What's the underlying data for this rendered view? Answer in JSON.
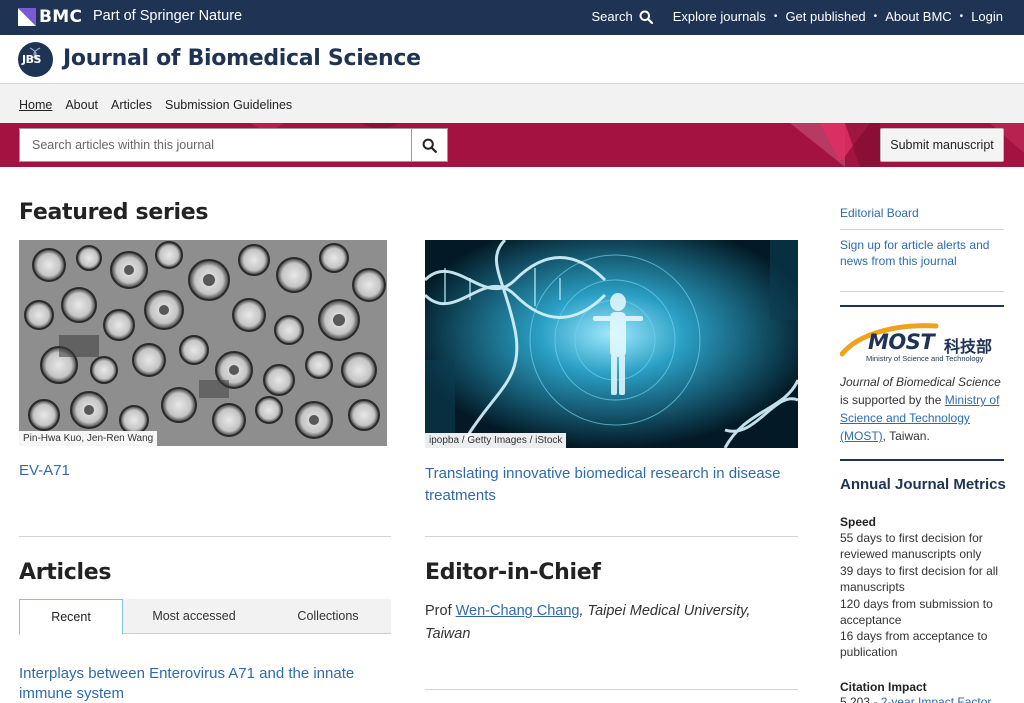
{
  "topbar": {
    "brand": "BMC",
    "tagline": "Part of Springer Nature",
    "search_label": "Search",
    "nav": [
      "Explore journals",
      "Get published",
      "About BMC",
      "Login"
    ],
    "separator": "•"
  },
  "journal": {
    "logo_text": "JBS",
    "title": "Journal of Biomedical Science"
  },
  "subnav": {
    "items": [
      "Home",
      "About",
      "Articles",
      "Submission Guidelines"
    ],
    "active": "Home"
  },
  "search": {
    "placeholder": "Search articles within this journal",
    "submit_manuscript": "Submit manuscript"
  },
  "featured": {
    "title": "Featured series",
    "items": [
      {
        "credit": "Pin-Hwa Kuo, Jen-Ren Wang",
        "link": "EV-A71"
      },
      {
        "credit": "ipopba / Getty Images / iStock",
        "link": "Translating innovative biomedical research in disease treatments"
      }
    ]
  },
  "articles": {
    "title": "Articles",
    "tabs": [
      "Recent",
      "Most accessed",
      "Collections"
    ],
    "active_tab": "Recent",
    "first_article": "Interplays between Enterovirus A71 and the innate immune system"
  },
  "editor": {
    "title": "Editor-in-Chief",
    "prefix": "Prof ",
    "name": "Wen-Chang Chang",
    "affiliation": ", Taipei Medical University, Taiwan"
  },
  "sidebar": {
    "editorial_board": "Editorial Board",
    "alerts": "Sign up for article alerts and news from this journal",
    "most_logo_text": "MOST",
    "most_logo_cn": "科技部",
    "most_logo_sub": "Ministry of Science and Technology",
    "support_journal": "Journal of Biomedical Science",
    "support_mid": " is supported by the ",
    "support_link": "Ministry of Science and Technology (MOST)",
    "support_end": ", Taiwan.",
    "metrics_title": "Annual Journal Metrics",
    "speed_head": "Speed",
    "speed_lines": [
      "55 days to first decision for reviewed manuscripts only",
      "39 days to first decision for all manuscripts",
      "120 days from submission to acceptance",
      "16 days from acceptance to publication"
    ],
    "citation_head": "Citation Impact",
    "citation_value": "5.203",
    "citation_sep": " - ",
    "citation_link": "2-year Impact Factor"
  },
  "colors": {
    "navy": "#1f3355",
    "crimson": "#a41242",
    "link": "#2e6bad"
  }
}
